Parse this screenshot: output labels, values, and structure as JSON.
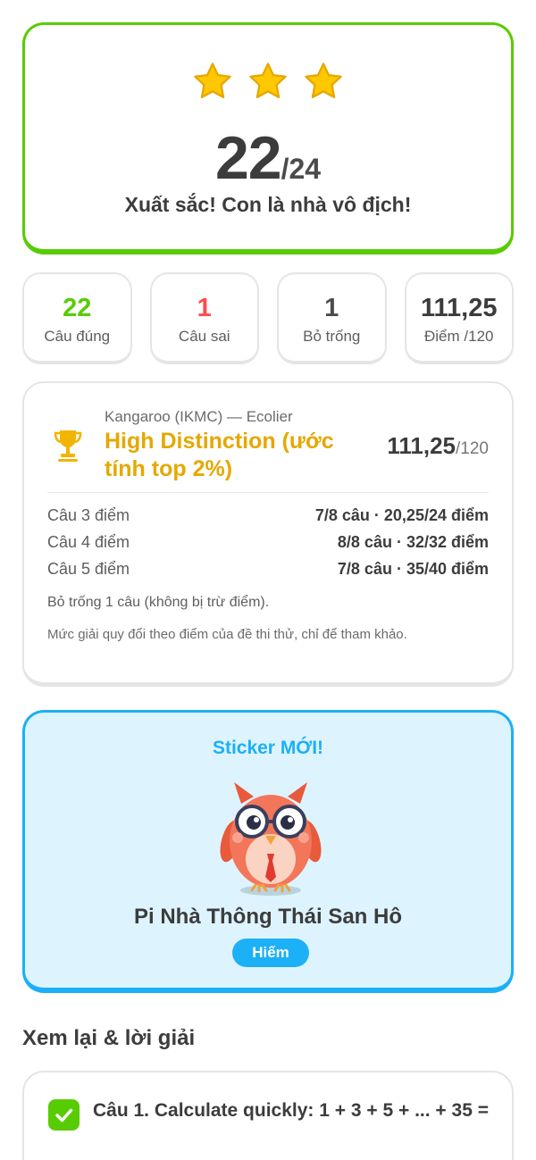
{
  "score": {
    "correct": "22",
    "total": "/24",
    "message": "Xuất sắc! Con là nhà vô địch!",
    "stars": 3,
    "star_color": "#ffc800"
  },
  "stats": [
    {
      "value": "22",
      "label": "Câu đúng",
      "color": "#58cc02"
    },
    {
      "value": "1",
      "label": "Câu sai",
      "color": "#ff4b4b"
    },
    {
      "value": "1",
      "label": "Bỏ trống",
      "color": "#4b4b4b"
    },
    {
      "value": "111,25",
      "label": "Điểm /120",
      "color": "#3c3c3c"
    }
  ],
  "result": {
    "competition": "Kangaroo (IKMC) — Ecolier",
    "award": "High Distinction (ước tính top 2%)",
    "points": "111,25",
    "points_max": "/120",
    "breakdown": [
      {
        "label": "Câu 3 điểm",
        "value": "7/8 câu · 20,25/24 điểm"
      },
      {
        "label": "Câu 4 điểm",
        "value": "8/8 câu · 32/32 điểm"
      },
      {
        "label": "Câu 5 điểm",
        "value": "7/8 câu · 35/40 điểm"
      }
    ],
    "note_blank": "Bỏ trống 1 câu (không bị trừ điểm).",
    "note_disclaimer": "Mức giải quy đổi theo điểm của đề thi thử, chỉ để tham khảo.",
    "award_color": "#e5a800"
  },
  "sticker": {
    "title": "Sticker MỚI!",
    "name": "Pi Nhà Thông Thái San Hô",
    "rarity": "Hiếm",
    "accent": "#1cb0f6"
  },
  "review": {
    "title": "Xem lại & lời giải",
    "questions": [
      {
        "text": "Câu 1. Calculate quickly: 1 + 3 + 5 + ... + 35 =",
        "status": "correct"
      }
    ]
  }
}
